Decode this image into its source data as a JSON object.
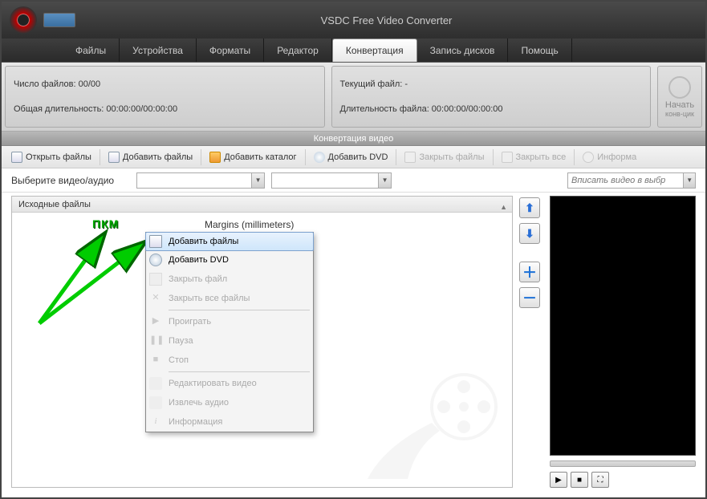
{
  "app_title": "VSDC Free Video Converter",
  "menu_tabs": [
    "Файлы",
    "Устройства",
    "Форматы",
    "Редактор",
    "Конвертация",
    "Запись дисков",
    "Помощь"
  ],
  "menu_active_index": 4,
  "ribbon": {
    "files_count_label": "Число файлов: 00/00",
    "total_duration_label": "Общая длительность: 00:00:00/00:00:00",
    "current_file_label": "Текущий файл: -",
    "file_duration_label": "Длительность файла: 00:00:00/00:00:00",
    "start_label": "Начать",
    "start_sub": "конв-цик"
  },
  "ribbon_footer": "Конвертация видео",
  "toolbar": {
    "open": "Открыть файлы",
    "add": "Добавить файлы",
    "add_folder": "Добавить каталог",
    "add_dvd": "Добавить DVD",
    "close": "Закрыть файлы",
    "close_all": "Закрыть все",
    "info": "Информа"
  },
  "selector": {
    "label": "Выберите видео/аудио",
    "fit_placeholder": "Вписать видео в выбр"
  },
  "panel": {
    "header": "Исходные файлы",
    "margins": "Margins (millimeters)"
  },
  "annotation": "ПКМ",
  "context_menu": [
    {
      "label": "Добавить файлы",
      "enabled": true,
      "highlight": true,
      "icon": "page-plus-icon"
    },
    {
      "label": "Добавить DVD",
      "enabled": true,
      "icon": "dvd-icon"
    },
    {
      "label": "Закрыть файл",
      "enabled": false,
      "icon": "page-minus-icon"
    },
    {
      "label": "Закрыть все файлы",
      "enabled": false,
      "icon": "close-x-icon"
    },
    {
      "sep": true
    },
    {
      "label": "Проиграть",
      "enabled": false,
      "icon": "play-icon"
    },
    {
      "label": "Пауза",
      "enabled": false,
      "icon": "pause-icon"
    },
    {
      "label": "Стоп",
      "enabled": false,
      "icon": "stop-icon"
    },
    {
      "sep": true
    },
    {
      "label": "Редактировать видео",
      "enabled": false,
      "icon": "edit-icon"
    },
    {
      "label": "Извлечь аудио",
      "enabled": false,
      "icon": "audio-extract-icon"
    },
    {
      "label": "Информация",
      "enabled": false,
      "icon": "info-icon"
    }
  ]
}
